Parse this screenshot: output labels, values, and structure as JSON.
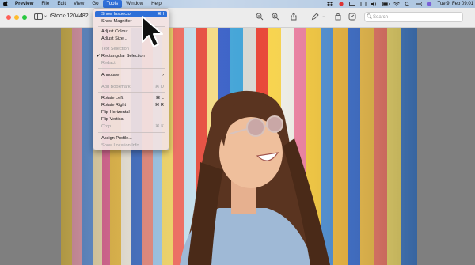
{
  "menubar": {
    "apple": "",
    "items": [
      "Preview",
      "File",
      "Edit",
      "View",
      "Go",
      "Tools",
      "Window",
      "Help"
    ],
    "clock": "Tue 9. Feb  09:01"
  },
  "window": {
    "title": "iStock-1204482",
    "search_placeholder": "Search"
  },
  "tools_menu": {
    "show_inspector": "Show Inspector",
    "show_inspector_sc": "⌘ I",
    "show_magnifier": "Show Magnifier",
    "adjust_colour": "Adjust Colour...",
    "adjust_size": "Adjust Size...",
    "text_selection": "Text Selection",
    "rect_selection": "Rectangular Selection",
    "redact": "Redact",
    "annotate": "Annotate",
    "add_bookmark": "Add Bookmark",
    "add_bookmark_sc": "⌘ D",
    "rotate_left": "Rotate Left",
    "rotate_left_sc": "⌘ L",
    "rotate_right": "Rotate Right",
    "rotate_right_sc": "⌘ R",
    "flip_horizontal": "Flip Horizontal",
    "flip_vertical": "Flip Vertical",
    "crop": "Crop",
    "crop_sc": "⌘ K",
    "assign_profile": "Assign Profile...",
    "show_location_info": "Show Location Info",
    "check": "✔",
    "submenu_arrow": "›"
  },
  "colors": {
    "menu_highlight": "#2f6fd8",
    "menubar": "#b7cde6",
    "window_bg": "#7f7f7f"
  }
}
